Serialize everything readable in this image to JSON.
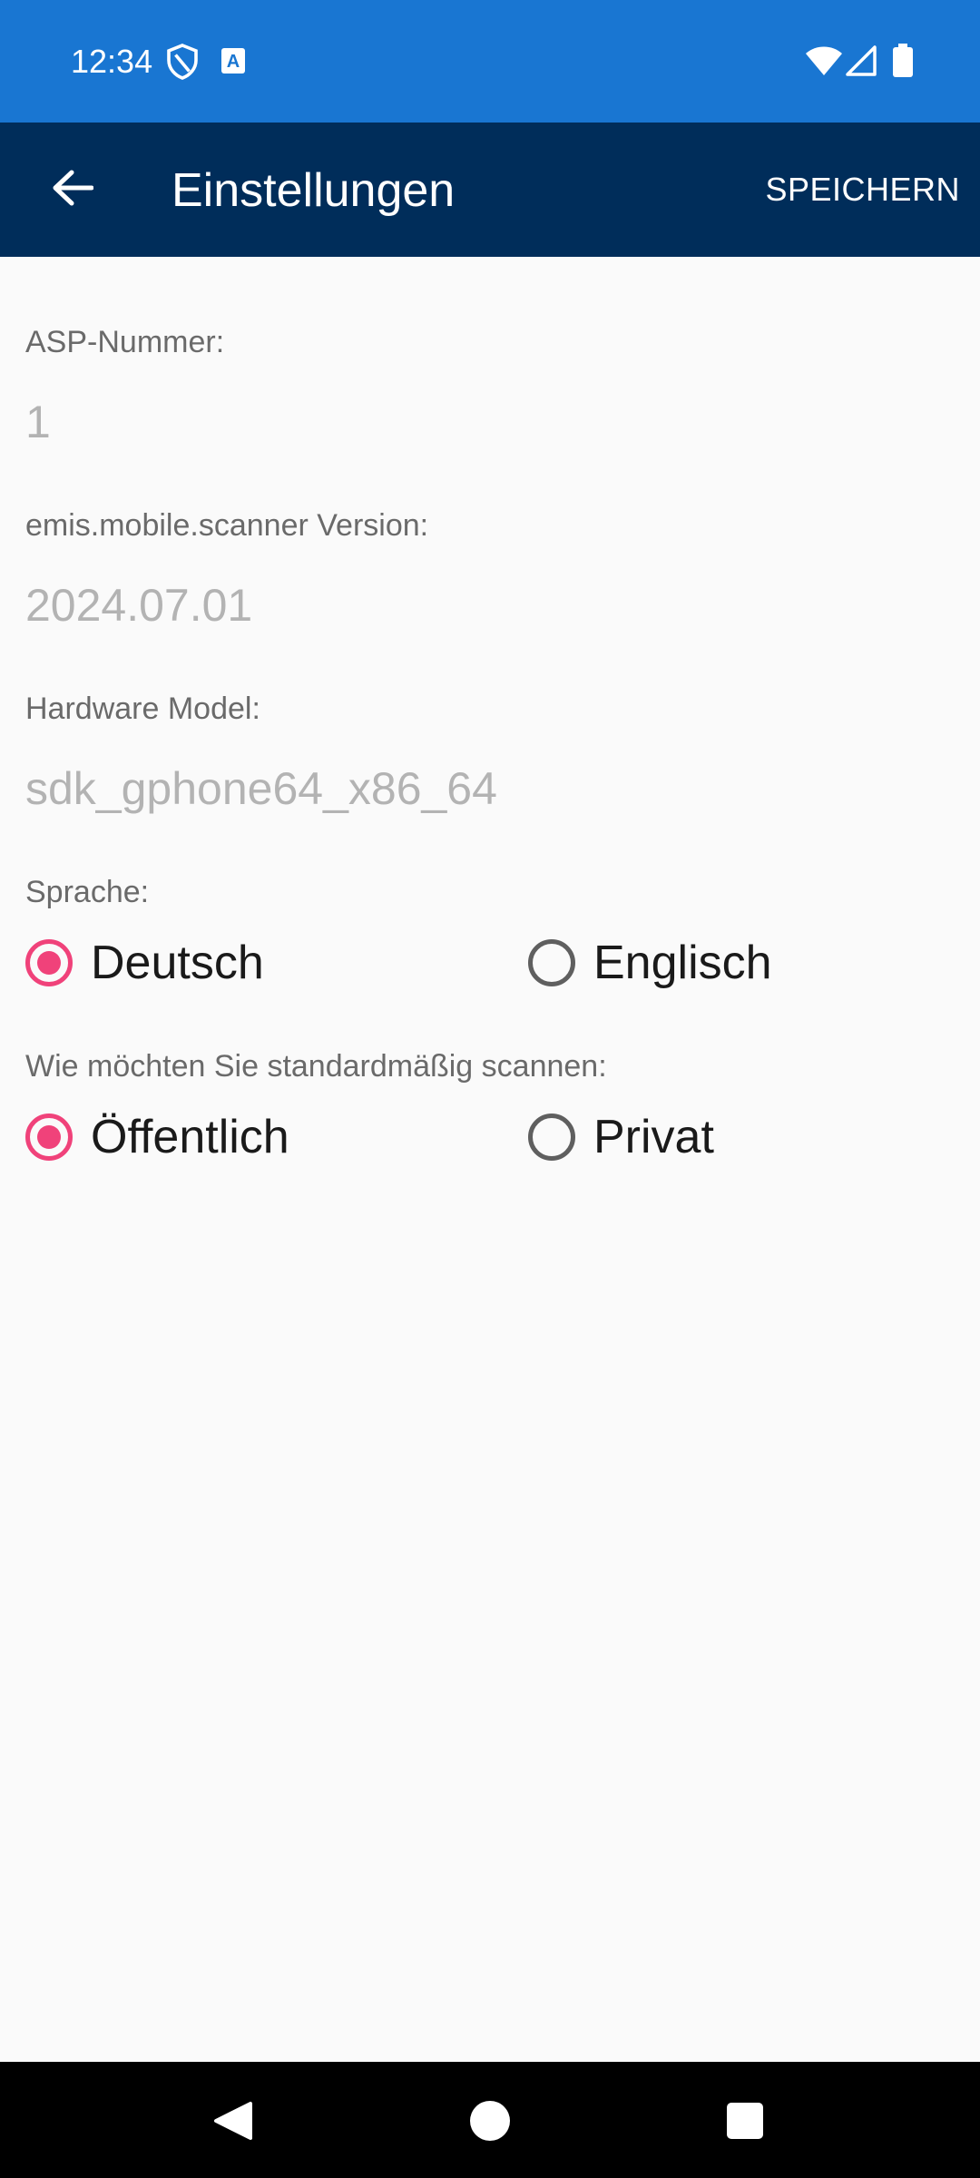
{
  "status_bar": {
    "time": "12:34",
    "icons": [
      "shield-icon",
      "a-notification-icon",
      "wifi-icon",
      "signal-icon",
      "battery-icon"
    ]
  },
  "app_bar": {
    "title": "Einstellungen",
    "save_label": "SPEICHERN",
    "back_icon": "arrow-left-icon"
  },
  "settings": {
    "asp": {
      "label": "ASP-Nummer:",
      "value": "1"
    },
    "version": {
      "label": "emis.mobile.scanner Version:",
      "value": "2024.07.01"
    },
    "hardware": {
      "label": "Hardware Model:",
      "value": "sdk_gphone64_x86_64"
    },
    "language": {
      "label": "Sprache:",
      "options": [
        {
          "label": "Deutsch",
          "checked": true
        },
        {
          "label": "Englisch",
          "checked": false
        }
      ]
    },
    "scan_mode": {
      "label": "Wie möchten Sie standardmäßig scannen:",
      "options": [
        {
          "label": "Öffentlich",
          "checked": true
        },
        {
          "label": "Privat",
          "checked": false
        }
      ]
    }
  },
  "nav_bar": {
    "icons": [
      "back-triangle-icon",
      "home-circle-icon",
      "recents-square-icon"
    ]
  },
  "colors": {
    "status_bar": "#1976d2",
    "app_bar": "#002d5a",
    "accent": "#f0427a",
    "background": "#fafafa"
  }
}
